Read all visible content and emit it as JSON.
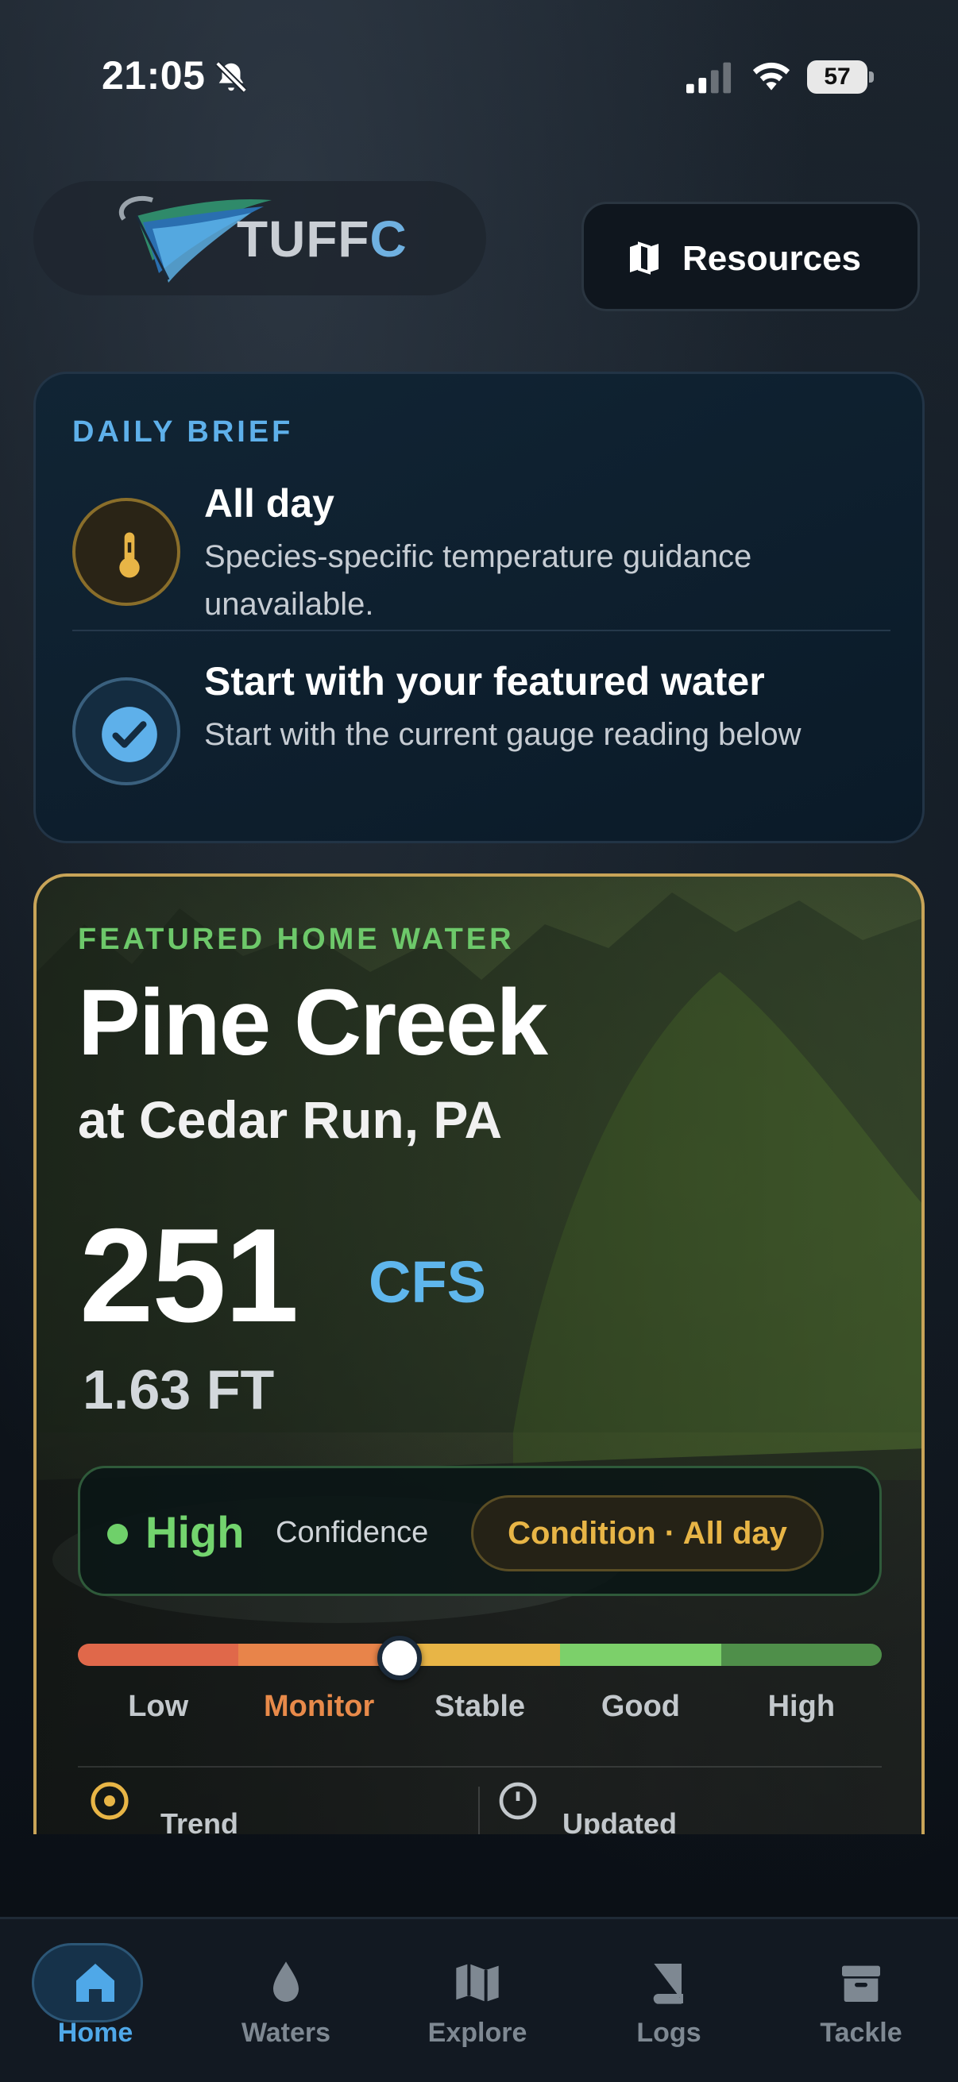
{
  "status_bar": {
    "time": "21:05",
    "battery": "57"
  },
  "header": {
    "logo_text_main": "TUFF",
    "logo_text_accent": "C",
    "resources_label": "Resources"
  },
  "daily_brief": {
    "title": "DAILY BRIEF",
    "items": [
      {
        "heading": "All day",
        "detail": "Species-specific temperature guidance unavailable.",
        "icon": "thermometer-icon"
      },
      {
        "heading": "Start with your featured water",
        "detail": "Start with the current gauge reading below",
        "icon": "check-icon"
      }
    ]
  },
  "featured": {
    "kicker": "FEATURED HOME WATER",
    "name": "Pine Creek",
    "location": "at Cedar Run, PA",
    "flow_value": "251",
    "flow_unit": "CFS",
    "stage": "1.63 FT",
    "confidence_level": "High",
    "confidence_label": "Confidence",
    "condition": "Condition · All day",
    "scale": {
      "labels": [
        "Low",
        "Monitor",
        "Stable",
        "Good",
        "High"
      ],
      "active_label": "Monitor",
      "segment_colors": [
        "#e0684a",
        "#e8844a",
        "#e8b546",
        "#7cd06a",
        "#4f8f4a"
      ],
      "marker_fraction": 0.4
    },
    "meta": {
      "trend_label": "Trend",
      "updated_label": "Updated"
    }
  },
  "bottom_nav": {
    "items": [
      {
        "label": "Home",
        "icon": "home-icon",
        "active": true
      },
      {
        "label": "Waters",
        "icon": "water-drop-icon",
        "active": false
      },
      {
        "label": "Explore",
        "icon": "map-icon",
        "active": false
      },
      {
        "label": "Logs",
        "icon": "book-icon",
        "active": false
      },
      {
        "label": "Tackle",
        "icon": "archive-box-icon",
        "active": false
      }
    ]
  },
  "colors": {
    "accent_blue": "#5eb0ea",
    "accent_green": "#6dc86a",
    "accent_gold": "#e8b546",
    "card_border_gold": "#c8a458"
  }
}
